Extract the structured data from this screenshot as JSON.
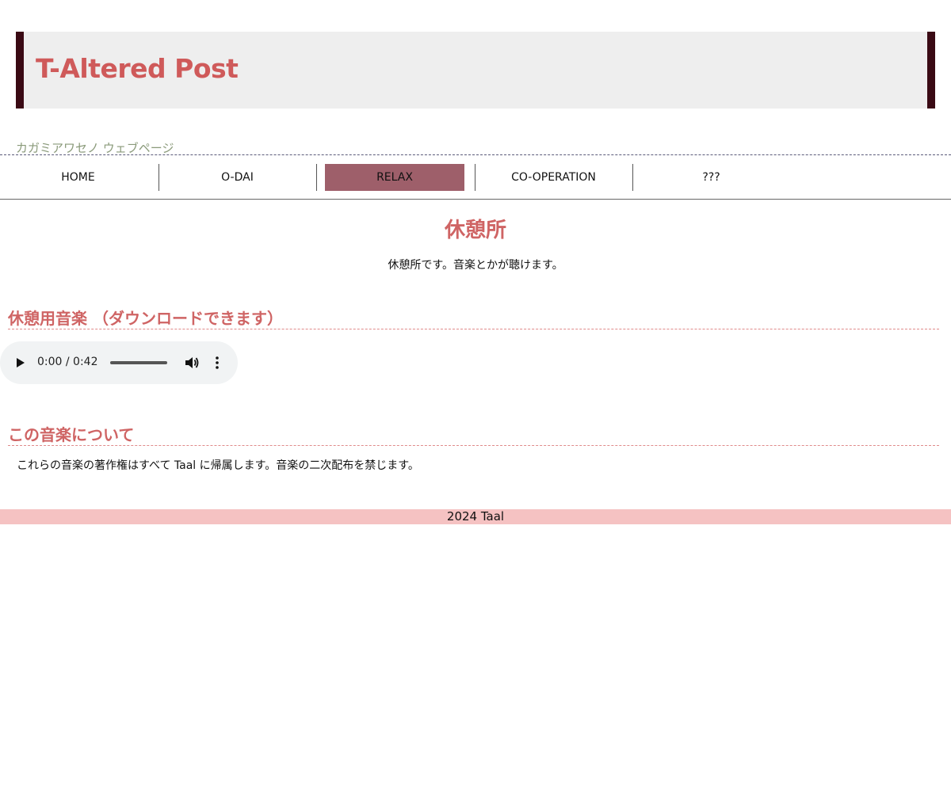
{
  "header": {
    "title": "T-Altered Post",
    "subtitle": "カガミアワセノ ウェブページ"
  },
  "nav": {
    "items": [
      {
        "label": "HOME"
      },
      {
        "label": "O-DAI"
      },
      {
        "label": "RELAX",
        "active": true
      },
      {
        "label": "CO-OPERATION"
      },
      {
        "label": "???"
      }
    ]
  },
  "main": {
    "heading": "休憩所",
    "intro": "休憩所です。音楽とかが聴けます。",
    "music_section": {
      "heading": "休憩用音楽 （ダウンロードできます）",
      "player": {
        "time": "0:00 / 0:42"
      }
    },
    "about_section": {
      "heading": "この音楽について",
      "text": "これらの音楽の著作権はすべて Taal に帰属します。音楽の二次配布を禁じます。"
    }
  },
  "footer": {
    "text": "2024 Taal"
  },
  "colors": {
    "accent": "#cf5a5a",
    "header_border": "#3a0a14",
    "nav_active": "#9e5f6a",
    "footer_bg": "#f5c2c2"
  }
}
